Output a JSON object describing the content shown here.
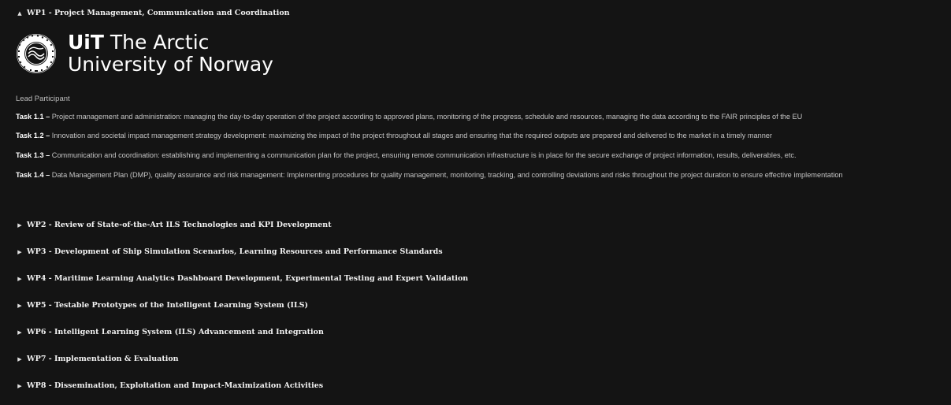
{
  "wp1": {
    "caret": "▲",
    "title": "WP1 - Project Management, Communication and Coordination",
    "logo": {
      "seal_text": "THE ARCTIC UNIVERSITY OF NORWAY · UIT",
      "brand_bold": "UiT",
      "brand_rest": " The Arctic",
      "brand_line2": "University of Norway"
    },
    "role_label": "Lead Participant",
    "tasks": [
      {
        "id": "Task 1.1 –",
        "text": " Project management and administration: managing the day-to-day operation of the project according to approved plans, monitoring of the progress, schedule and resources, managing the data according to the FAIR principles of the EU"
      },
      {
        "id": "Task 1.2 –",
        "text": " Innovation and societal impact management strategy development: maximizing the impact of the project throughout all stages and ensuring that the required outputs are prepared and delivered to the market in a timely manner"
      },
      {
        "id": "Task 1.3 –",
        "text": " Communication and coordination: establishing and implementing a communication plan for the project, ensuring remote communication infrastructure is in place for the secure exchange of project information, results, deliverables, etc."
      },
      {
        "id": "Task 1.4 –",
        "text": " Data Management Plan (DMP), quality assurance and risk management: Implementing procedures for quality management, monitoring, tracking, and controlling deviations and risks throughout the project duration to ensure effective implementation"
      }
    ]
  },
  "collapsed_caret": "▶",
  "work_packages": [
    {
      "title": "WP2 - Review of State-of-the-Art ILS Technologies and KPI Development"
    },
    {
      "title": "WP3 - Development of Ship Simulation Scenarios, Learning Resources and Performance Standards"
    },
    {
      "title": "WP4 - Maritime Learning Analytics Dashboard Development, Experimental Testing and Expert Validation"
    },
    {
      "title": "WP5 - Testable Prototypes of the Intelligent Learning System (ILS)"
    },
    {
      "title": "WP6 - Intelligent Learning System (ILS) Advancement and Integration"
    },
    {
      "title": "WP7 - Implementation & Evaluation"
    },
    {
      "title": "WP8 - Dissemination, Exploitation and Impact-Maximization Activities"
    }
  ],
  "colors": {
    "background": "#141414",
    "text": "#c4c4c4",
    "heading": "#f2f2f2"
  }
}
